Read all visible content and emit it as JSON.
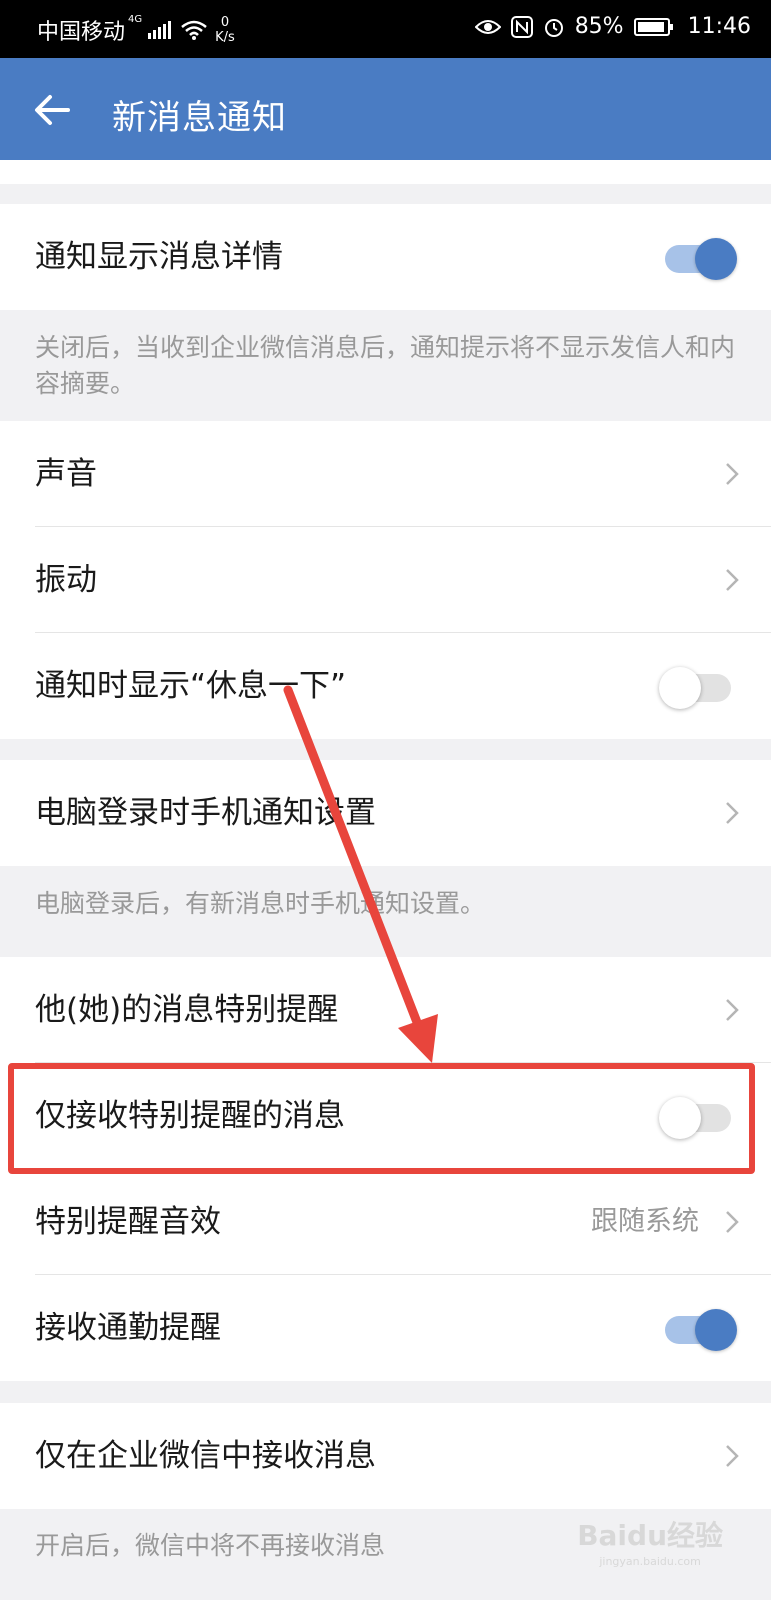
{
  "status_bar": {
    "carrier": "中国移动",
    "network_type": "4G",
    "net_speed_value": "0",
    "net_speed_unit": "K/s",
    "battery": "85%",
    "time": "11:46"
  },
  "app_bar": {
    "title": "新消息通知"
  },
  "sections": {
    "show_details": {
      "label": "通知显示消息详情",
      "on": true
    },
    "show_details_hint": "关闭后，当收到企业微信消息后，通知提示将不显示发信人和内容摘要。",
    "sound": {
      "label": "声音"
    },
    "vibration": {
      "label": "振动"
    },
    "show_rest": {
      "label": "通知时显示“休息一下”",
      "on": false
    },
    "pc_login": {
      "label": "电脑登录时手机通知设置"
    },
    "pc_login_hint": "电脑登录后，有新消息时手机通知设置。",
    "special_reminder": {
      "label": "他(她)的消息特别提醒"
    },
    "only_special": {
      "label": "仅接收特别提醒的消息",
      "on": false
    },
    "special_sound": {
      "label": "特别提醒音效",
      "value": "跟随系统"
    },
    "commute": {
      "label": "接收通勤提醒",
      "on": true
    },
    "only_wecom": {
      "label": "仅在企业微信中接收消息"
    },
    "only_wecom_hint": "开启后，微信中将不再接收消息"
  },
  "watermark": {
    "text": "Baidu经验",
    "sub": "jingyan.baidu.com"
  },
  "colors": {
    "accent": "#4a7cc3",
    "highlight": "#e8453c"
  }
}
